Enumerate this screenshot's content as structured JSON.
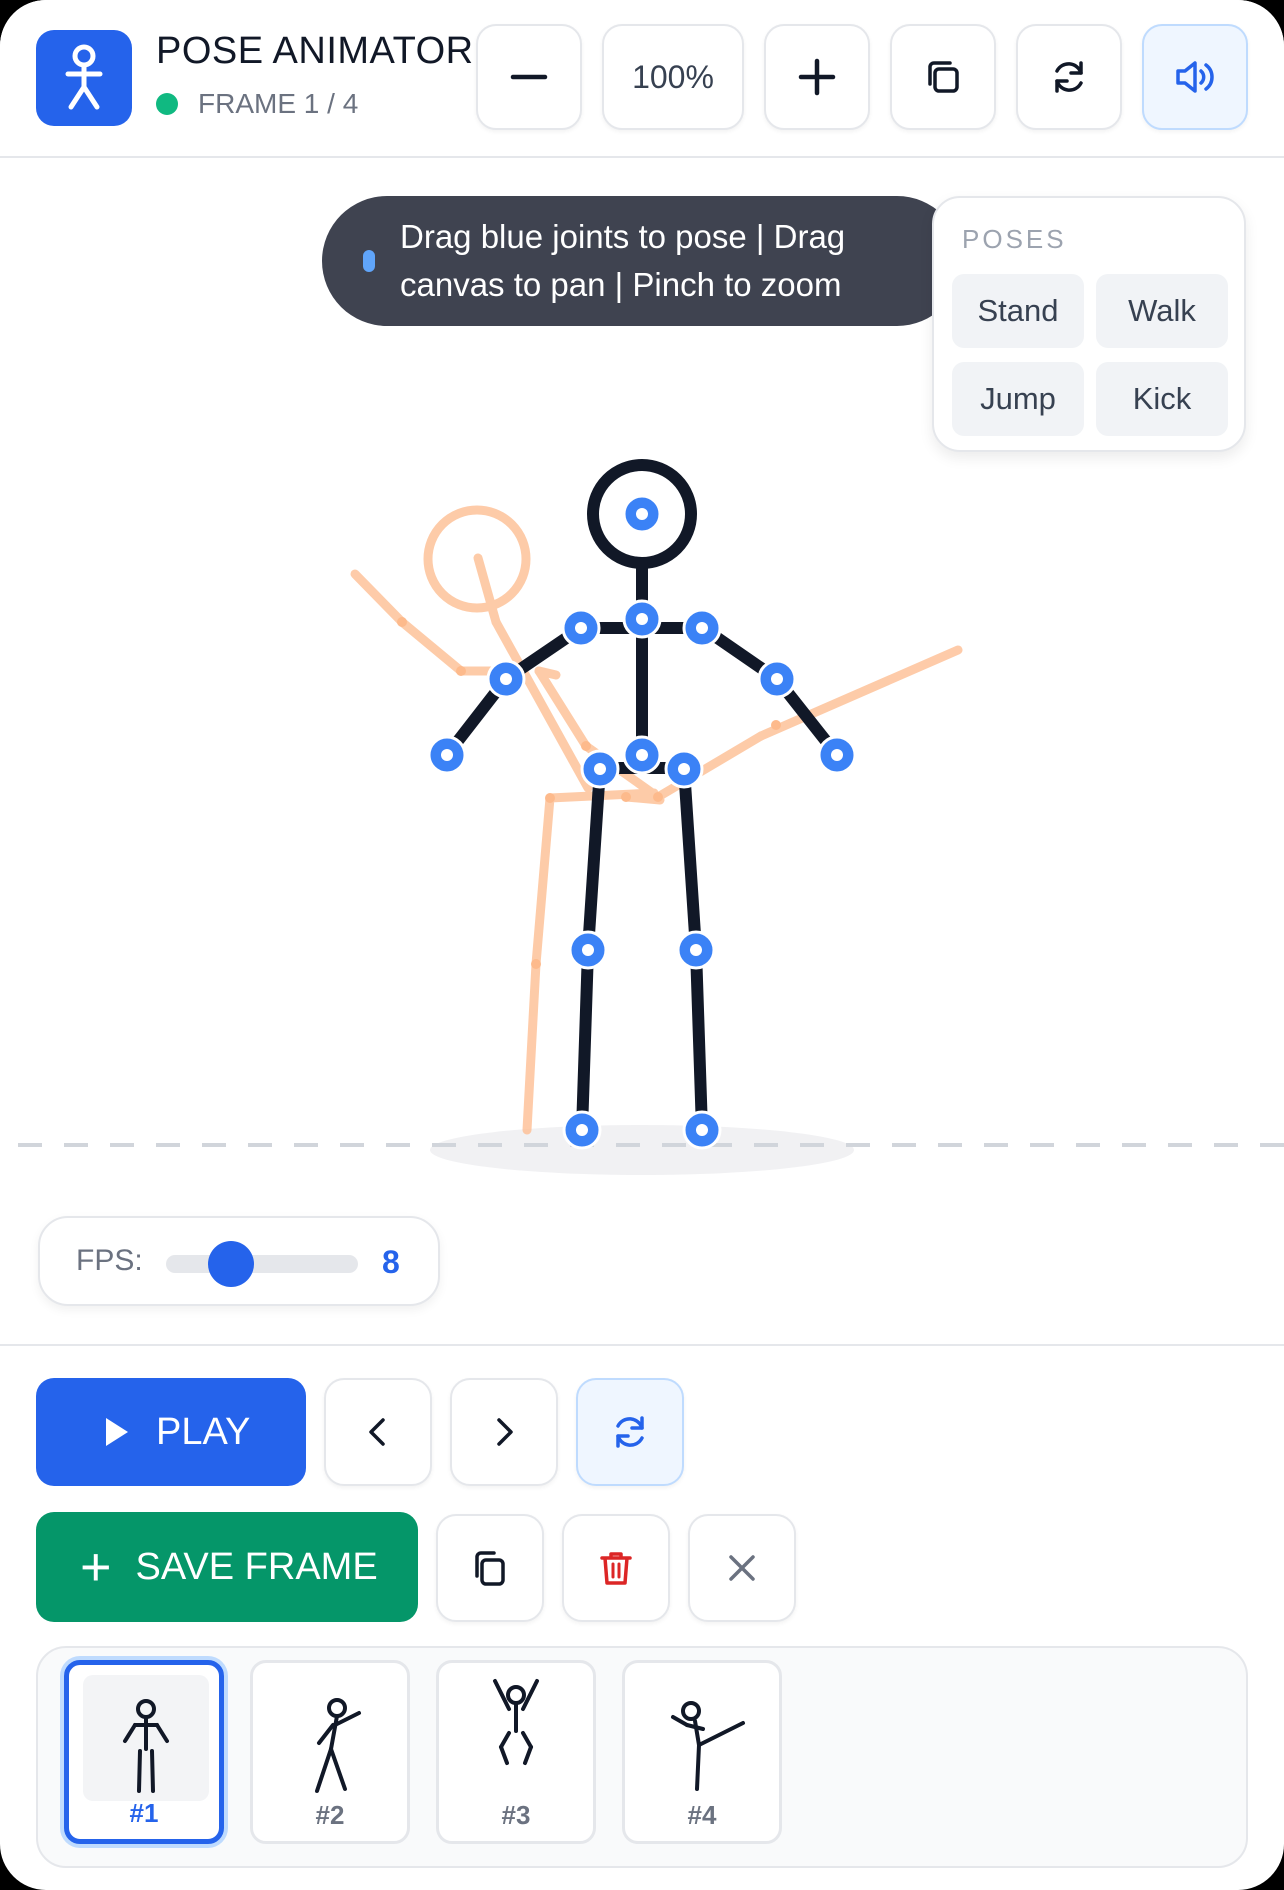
{
  "app": {
    "title": "POSE ANIMATOR",
    "frame_status": "FRAME 1 / 4",
    "status_color": "#10b981",
    "accent_color": "#2563eb"
  },
  "toolbar": {
    "zoom_label": "100%",
    "icons": [
      "minus-icon",
      "plus-icon",
      "copy-icon",
      "refresh-icon",
      "volume-icon"
    ]
  },
  "hint": {
    "text": "Drag blue joints to pose | Drag canvas to pan | Pinch to zoom"
  },
  "poses": {
    "title": "POSES",
    "items": [
      "Stand",
      "Walk",
      "Jump",
      "Kick"
    ]
  },
  "fps": {
    "label": "FPS:",
    "value": "8"
  },
  "controls": {
    "play_label": "PLAY",
    "save_label": "SAVE FRAME",
    "icons": [
      "play-icon",
      "chevron-left-icon",
      "chevron-right-icon",
      "loop-icon",
      "duplicate-icon",
      "trash-icon",
      "close-icon"
    ]
  },
  "timeline": {
    "frames": [
      {
        "label": "#1",
        "pose": "Stand",
        "selected": true
      },
      {
        "label": "#2",
        "pose": "Walk",
        "selected": false
      },
      {
        "label": "#3",
        "pose": "Jump",
        "selected": false
      },
      {
        "label": "#4",
        "pose": "Kick",
        "selected": false
      }
    ]
  },
  "colors": {
    "skeleton": "#111827",
    "joint": "#3b82f6",
    "onion_skin": "#fdba8c",
    "save": "#059669",
    "delete": "#dc2626"
  }
}
